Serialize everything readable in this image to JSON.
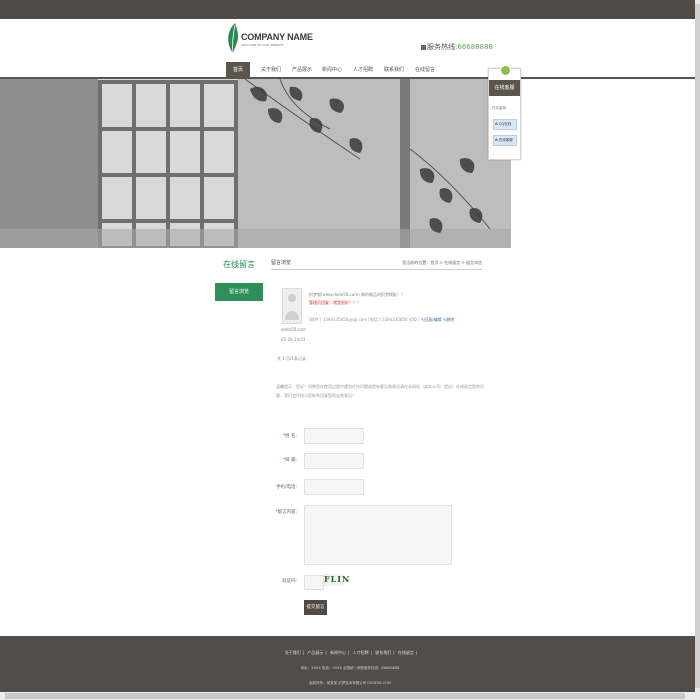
{
  "header": {
    "logo_name": "COMPANY NAME",
    "logo_sub": "WELCOME TO OUR WEBSITE",
    "hotline_label": "服务热线:",
    "hotline_number": "66688888"
  },
  "nav": {
    "items": [
      {
        "label": "首页",
        "active": true
      },
      {
        "label": "关于我们",
        "active": false
      },
      {
        "label": "产品展示",
        "active": false
      },
      {
        "label": "新闻中心",
        "active": false
      },
      {
        "label": "人才招聘",
        "active": false
      },
      {
        "label": "联系我们",
        "active": false
      },
      {
        "label": "在线留言",
        "active": false
      }
    ]
  },
  "service": {
    "title": "在线客服",
    "label": "在线客服",
    "buttons": [
      "QQ在线",
      "在线客服"
    ]
  },
  "sidebar": {
    "title": "在线留言",
    "button": "留言浏览"
  },
  "main": {
    "title": "留言浏览",
    "breadcrumb": "您当前的位置：首页 > 在线留言 > 留言浏览",
    "entry": {
      "user": "dede58.com",
      "date": "05-26 14:03",
      "line1": "织梦猫(www.dede58.com) 做的最品的织梦模板！！",
      "line2": "管理员回复：就是很好！！！",
      "line3_prefix": "[邮件:]  3394335856@qq.com  [电话:]  3394335856  [QQ:]",
      "link_reply": "回复/编辑",
      "link_delete": "删除"
    },
    "count": "共 1 页/1条记录",
    "notice": "温馨提示：您好！如果您在使用过程中遇到任何问题或是有意见和建议请在本网站（或本公司）提出！在线留言您的问题，我们会尽快与您联系回复您的宝贵意见！"
  },
  "form": {
    "name_label": "姓    名：",
    "email_label": "邮    箱：",
    "phone_label": "手机/电话：",
    "content_label": "留言内容：",
    "captcha_label": "验证码：",
    "captcha_text": "FLIN",
    "submit": "提交留言"
  },
  "footer": {
    "links": [
      "关于我们",
      "产品展示",
      "新闻中心",
      "人才招聘",
      "联系我们",
      "在线留言"
    ],
    "line2": "地址：XXXX  电话：XXXX  全国统一销售服务热线：66688888",
    "line3": "版权所有：某某某 织梦技术有限公司  DEDE58.COM"
  },
  "colors": {
    "dark_brand": "#5c554c",
    "accent_green": "#2f8f5a",
    "alert_red": "#e02020"
  }
}
